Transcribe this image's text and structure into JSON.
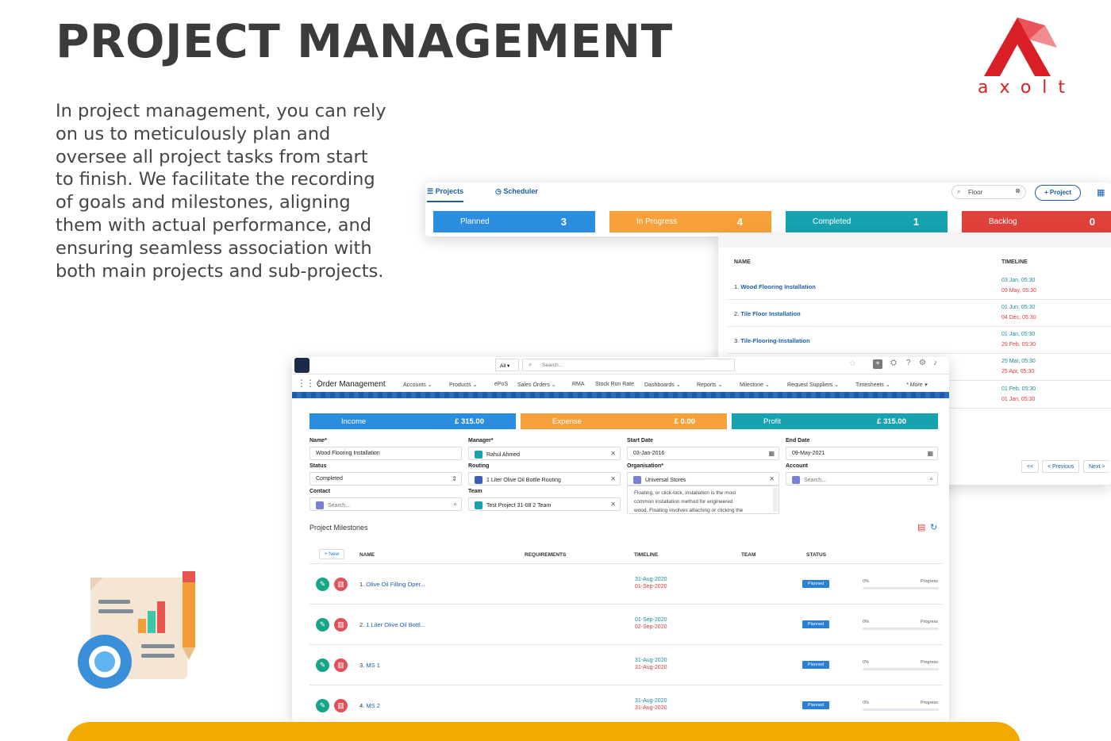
{
  "page": {
    "title": "PROJECT MANAGEMENT",
    "description": "In project management, you can rely on us to meticulously plan and oversee all project tasks from start to finish. We facilitate the recording of goals and milestones, aligning them with actual performance, and ensuring seamless association with both main projects and sub-projects.",
    "logo_text": "axolt"
  },
  "colors": {
    "brand_red": "#d81f26",
    "planned": "#2a8de0",
    "in_progress": "#f7a13b",
    "completed": "#17a2b0",
    "backlog": "#e0413b",
    "link": "#1b5fa8",
    "footer_yellow": "#f2a900"
  },
  "projects_panel": {
    "tabs": [
      {
        "label": "Projects",
        "icon": "list-icon",
        "active": true
      },
      {
        "label": "Scheduler",
        "icon": "clock-icon",
        "active": false
      }
    ],
    "search": {
      "value": "Floor",
      "icon": "search-icon",
      "clear_icon": "clear-icon"
    },
    "add_button": "+ Project",
    "view_icon": "grid-icon",
    "kpis": [
      {
        "label": "Planned",
        "count": "3"
      },
      {
        "label": "In Progress",
        "count": "4"
      },
      {
        "label": "Completed",
        "count": "1"
      },
      {
        "label": "Backlog",
        "count": "0"
      }
    ]
  },
  "project_table": {
    "headers": {
      "name": "NAME",
      "timeline": "TIMELINE"
    },
    "rows": [
      {
        "num": "1.",
        "name": "Wood Flooring Installation",
        "start": "03 Jan, 05:30",
        "end": "09 May, 05:30"
      },
      {
        "num": "2.",
        "name": "Tile Floor Installation",
        "start": "01 Jun, 05:30",
        "end": "04 Dec, 05:30"
      },
      {
        "num": "3.",
        "name": "Tile-Flooring-Installation",
        "start": "01 Jan, 05:30",
        "end": "29 Feb, 05:30"
      },
      {
        "num": "",
        "name": "",
        "start": "25 Mar, 05:30",
        "end": "25 Apr, 05:30"
      },
      {
        "num": "",
        "name": "",
        "start": "01 Feb, 05:30",
        "end": "01 Jan, 05:30"
      }
    ],
    "pager": {
      "first": "<<",
      "prev": "< Previous",
      "next": "Next >"
    }
  },
  "order_app": {
    "global_header": {
      "scope": "All",
      "search_placeholder": "Search...",
      "icons": [
        "star-icon",
        "add-icon",
        "setup-icon",
        "help-icon",
        "gear-icon",
        "bell-icon"
      ]
    },
    "app_name": "Order Management",
    "nav": [
      "Accounts",
      "Products",
      "ePoS",
      "Sales Orders",
      "RMA",
      "Stock Run Rate",
      "Dashboards",
      "Reports",
      "Milestone",
      "Request Suppliers",
      "Timesheets",
      "* More"
    ],
    "summary": [
      {
        "label": "Income",
        "value": "£ 315.00"
      },
      {
        "label": "Expense",
        "value": "£ 0.00"
      },
      {
        "label": "Profit",
        "value": "£ 315.00"
      }
    ],
    "form": {
      "name": {
        "label": "Name*",
        "value": "Wood Flooring Installation"
      },
      "manager": {
        "label": "Manager*",
        "value": "Rahul Ahmed"
      },
      "start_date": {
        "label": "Start Date",
        "value": "03-Jan-2016"
      },
      "end_date": {
        "label": "End Date",
        "value": "09-May-2021"
      },
      "status": {
        "label": "Status",
        "value": "Completed"
      },
      "routing": {
        "label": "Routing",
        "value": "1 Liter Olive Oil Bottle Routing"
      },
      "organisation": {
        "label": "Organisation*",
        "value": "Universal Stores"
      },
      "account": {
        "label": "Account",
        "placeholder": "Search..."
      },
      "contact": {
        "label": "Contact",
        "placeholder": "Search..."
      },
      "team": {
        "label": "Team",
        "value": "Test Project 31-08 2 Team"
      },
      "notes_line1": "Floating, or click-lock, installation is the most",
      "notes_line2": "common installation method for engineered",
      "notes_line3": "wood. Floating involves attaching or clicking the"
    },
    "milestones": {
      "title": "Project Milestones",
      "new_button": "+ New",
      "headers": {
        "name": "NAME",
        "requirements": "REQUIREMENTS",
        "timeline": "TIMELINE",
        "team": "TEAM",
        "status": "STATUS"
      },
      "rows": [
        {
          "num": "1.",
          "name": "Olive Oil Filling Oper...",
          "start": "31-Aug-2020",
          "end": "01-Sep-2020",
          "status": "Planned",
          "pct": "0%",
          "progress_label": "Progress",
          "progress": 0
        },
        {
          "num": "2.",
          "name": "1 Liter Olive Oil Bottl...",
          "start": "01-Sep-2020",
          "end": "02-Sep-2020",
          "status": "Planned",
          "pct": "0%",
          "progress_label": "Progress",
          "progress": 0
        },
        {
          "num": "3.",
          "name": "MS 1",
          "start": "31-Aug-2020",
          "end": "31-Aug-2020",
          "status": "Planned",
          "pct": "0%",
          "progress_label": "Progress",
          "progress": 0
        },
        {
          "num": "4.",
          "name": "MS 2",
          "start": "31-Aug-2020",
          "end": "31-Aug-2020",
          "status": "Planned",
          "pct": "0%",
          "progress_label": "Progress",
          "progress": 0
        }
      ]
    }
  }
}
